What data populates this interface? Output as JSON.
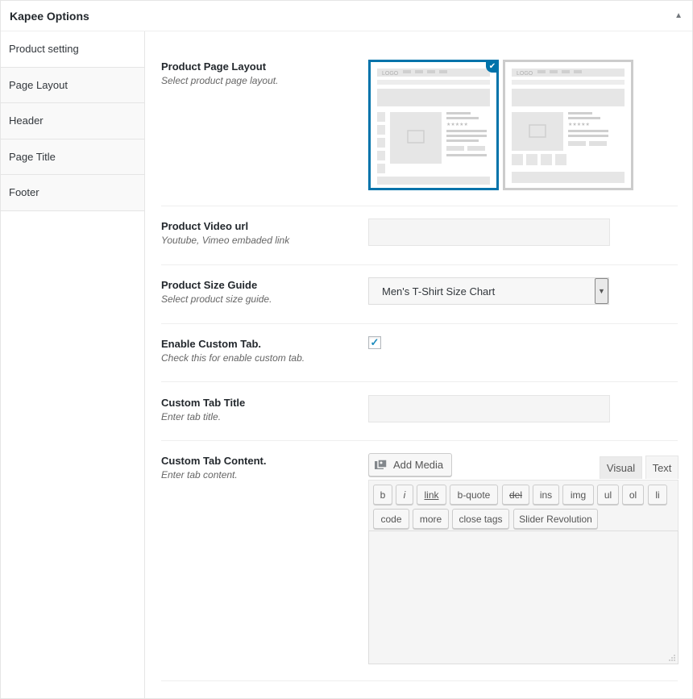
{
  "metabox": {
    "title": "Kapee Options",
    "toggle_icon": "triangle-up-icon"
  },
  "sidebar": {
    "items": [
      {
        "label": "Product setting"
      },
      {
        "label": "Page Layout"
      },
      {
        "label": "Header"
      },
      {
        "label": "Page Title"
      },
      {
        "label": "Footer"
      }
    ]
  },
  "fields": {
    "layout": {
      "label": "Product Page Layout",
      "desc": "Select product page layout.",
      "selected_index": 0,
      "logo_text": "LOGO"
    },
    "video": {
      "label": "Product Video url",
      "desc": "Youtube, Vimeo embaded link",
      "value": ""
    },
    "size_guide": {
      "label": "Product Size Guide",
      "desc": "Select product size guide.",
      "value": "Men's T-Shirt Size Chart"
    },
    "custom_tab": {
      "label": "Enable Custom Tab.",
      "desc": "Check this for enable custom tab.",
      "checked": true
    },
    "tab_title": {
      "label": "Custom Tab Title",
      "desc": "Enter tab title.",
      "value": ""
    },
    "tab_content": {
      "label": "Custom Tab Content.",
      "desc": "Enter tab content.",
      "add_media": "Add Media",
      "tabs": {
        "visual": "Visual",
        "text": "Text"
      },
      "quicktags": [
        "b",
        "i",
        "link",
        "b-quote",
        "del",
        "ins",
        "img",
        "ul",
        "ol",
        "li",
        "code",
        "more",
        "close tags",
        "Slider Revolution"
      ]
    }
  },
  "colors": {
    "accent": "#0073aa",
    "border": "#e5e5e5"
  }
}
